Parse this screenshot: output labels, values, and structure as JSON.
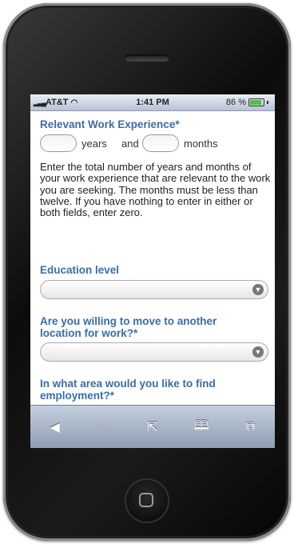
{
  "status_bar": {
    "carrier": "AT&T",
    "time": "1:41 PM",
    "battery": "86 %",
    "battery_level": 0.86,
    "wifi_icon": "wifi-icon"
  },
  "form": {
    "experience": {
      "label": "Relevant Work Experience*",
      "years_value": "",
      "years_text": "years",
      "and_text": "and",
      "months_value": "",
      "months_text": "months",
      "help": "Enter the total number of years and months of your work experience that are relevant to the work you are seeking. The months must be less than twelve. If you have nothing to enter in either or both fields, enter zero."
    },
    "education": {
      "label": "Education level",
      "value": ""
    },
    "relocate": {
      "label": "Are you willing to move to another location for work?*",
      "value": ""
    },
    "area": {
      "label": "In what area would you like to find employment?*"
    }
  },
  "toolbar": {
    "back_icon": "◀",
    "forward_icon": "▶",
    "share_icon": "⇱",
    "bookmarks_icon": "🕮",
    "pages_icon": "⧉"
  }
}
